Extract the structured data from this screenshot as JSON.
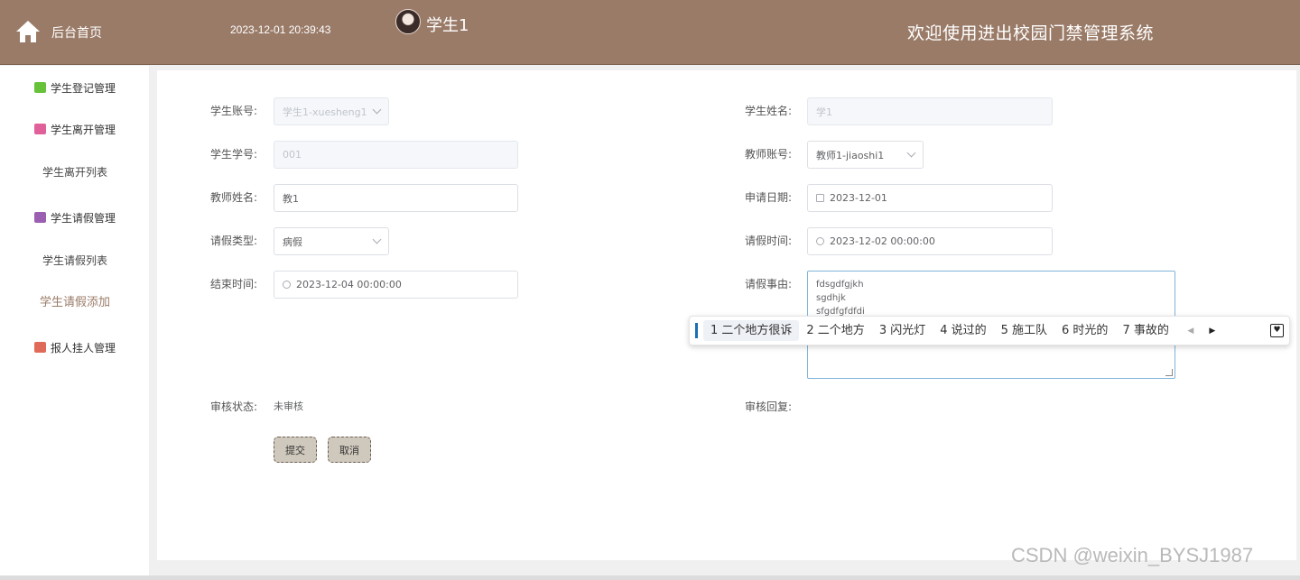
{
  "header": {
    "home_label": "后台首页",
    "datetime": "2023-12-01 20:39:43",
    "username": "学生1",
    "site_title": "欢迎使用进出校园门禁管理系统",
    "bg_color": "#9a7b68"
  },
  "sidebar": {
    "items": [
      {
        "label": "学生登记管理",
        "icon": "chat-icon",
        "color": "#67c23a"
      },
      {
        "label": "学生离开管理",
        "icon": "lock-icon",
        "color": "#e0609a"
      },
      {
        "label": "学生离开列表"
      },
      {
        "label": "学生请假管理",
        "icon": "archive-icon",
        "color": "#9a5fb0"
      },
      {
        "label": "学生请假列表"
      },
      {
        "label": "学生请假添加"
      },
      {
        "label": "报人挂人管理",
        "icon": "apps-icon",
        "color": "#e06a5a"
      }
    ]
  },
  "form": {
    "student_account_label": "学生账号:",
    "student_account_value": "学生1-xuesheng1",
    "student_name_label": "学生姓名:",
    "student_name_value": "学1",
    "student_number_label": "学生学号:",
    "student_number_value": "001",
    "teacher_account_label": "教师账号:",
    "teacher_account_value": "教师1-jiaoshi1",
    "teacher_name_label": "教师姓名:",
    "teacher_name_value": "教1",
    "apply_date_label": "申请日期:",
    "apply_date_value": "2023-12-01",
    "leave_type_label": "请假类型:",
    "leave_type_value": "病假",
    "leave_time_label": "请假时间:",
    "leave_time_value": "2023-12-02 00:00:00",
    "end_time_label": "结束时间:",
    "end_time_value": "2023-12-04 00:00:00",
    "reason_label": "请假事由:",
    "reason_lines": [
      "fdsgdfgjkh",
      "sgdhjk",
      "sfgdfgfdfdi"
    ],
    "review_status_label": "审核状态:",
    "review_status_value": "未审核",
    "review_reply_label": "审核回复:",
    "submit_label": "提交",
    "cancel_label": "取消"
  },
  "ime": {
    "candidates": [
      "1 二个地方很诉",
      "2 二个地方",
      "3 闪光灯",
      "4 说过的",
      "5 施工队",
      "6 时光的",
      "7 事故的"
    ],
    "prev": "◀",
    "next": "▶",
    "fav": "♥"
  },
  "watermark": "CSDN @weixin_BYSJ1987"
}
